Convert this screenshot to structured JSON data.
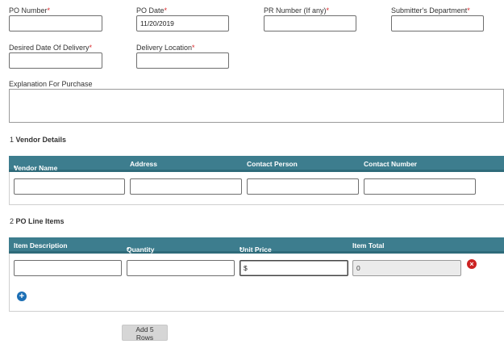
{
  "header_fields": {
    "po_number": {
      "label": "PO Number",
      "value": ""
    },
    "po_date": {
      "label": "PO Date",
      "value": "11/20/2019"
    },
    "pr_number": {
      "label": "PR Number (If any)",
      "value": ""
    },
    "submitter_department": {
      "label": "Submitter's Department",
      "value": ""
    },
    "desired_date": {
      "label": "Desired Date Of Delivery",
      "value": ""
    },
    "delivery_location": {
      "label": "Delivery Location",
      "value": ""
    },
    "explanation": {
      "label": "Explanation For Purchase",
      "value": ""
    }
  },
  "required_marker": "*",
  "vendor_section": {
    "number": "1",
    "title": "Vendor Details",
    "columns": [
      "Vendor Name",
      "Address",
      "Contact Person",
      "Contact Number"
    ],
    "row": [
      "",
      "",
      "",
      ""
    ]
  },
  "line_items_section": {
    "number": "2",
    "title": "PO Line Items",
    "columns": [
      "Item Description",
      "Quantity",
      "Unit Price",
      "Item Total"
    ],
    "row": [
      "",
      "",
      "$",
      "0"
    ]
  },
  "add_rows_label": "Add 5 Rows",
  "icons": {
    "delete": "remove-row-icon",
    "add": "add-row-icon"
  },
  "colors": {
    "grid_header": "#3d7d8e",
    "required": "#d9282a",
    "delete_icon": "#cc2222",
    "add_icon": "#1c6fb5"
  }
}
